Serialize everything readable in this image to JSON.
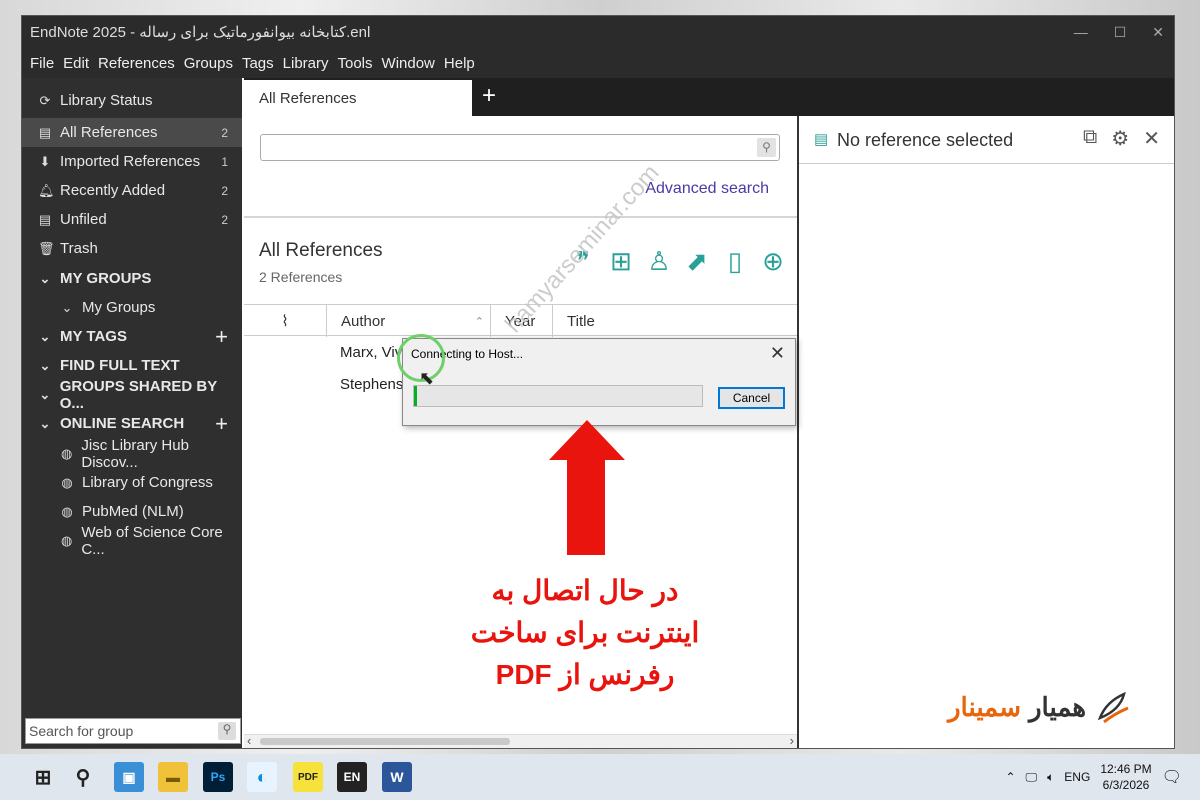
{
  "window": {
    "title": "EndNote 2025 - کتابخانه بیوانفورماتیک برای رساله.enl"
  },
  "menu": [
    "File",
    "Edit",
    "References",
    "Groups",
    "Tags",
    "Library",
    "Tools",
    "Window",
    "Help"
  ],
  "sidebar": {
    "library_status": "Library Status",
    "items": [
      {
        "label": "All References",
        "count": "2"
      },
      {
        "label": "Imported References",
        "count": "1"
      },
      {
        "label": "Recently Added",
        "count": "2"
      },
      {
        "label": "Unfiled",
        "count": "2"
      },
      {
        "label": "Trash",
        "count": ""
      }
    ],
    "my_groups_header": "MY GROUPS",
    "my_groups_sub": "My Groups",
    "my_tags_header": "MY TAGS",
    "find_full_text": "FIND FULL TEXT",
    "groups_shared": "GROUPS SHARED BY O...",
    "online_search": "ONLINE SEARCH",
    "online_items": [
      "Jisc Library Hub Discov...",
      "Library of Congress",
      "PubMed (NLM)",
      "Web of Science Core C..."
    ],
    "search_placeholder": "Search for group"
  },
  "tabs": {
    "active": "All References",
    "add": "+"
  },
  "center": {
    "advanced_search": "Advanced search",
    "title": "All References",
    "count": "2 References",
    "columns": {
      "author": "Author",
      "year": "Year",
      "title": "Title"
    },
    "rows": [
      {
        "author": "Marx, Vivi"
      },
      {
        "author": "Stephens,"
      }
    ]
  },
  "right": {
    "title": "No reference selected"
  },
  "dialog": {
    "title": "Connecting to Host...",
    "cancel": "Cancel",
    "progress": 0.01
  },
  "overlay": {
    "caption_line1": "در حال اتصال به",
    "caption_line2": "اینترنت برای ساخت",
    "caption_line3": "رفرنس از PDF",
    "watermark": "hamyarseminar.com",
    "logo_1": "همیار",
    "logo_2": "سمینار"
  },
  "taskbar": {
    "lang": "ENG",
    "time": "12:46 PM",
    "date": "6/3/2026"
  },
  "colors": {
    "accent": "#2aa198",
    "link": "#4b3aa6",
    "alert": "#e8140d",
    "progress": "#06b025"
  }
}
